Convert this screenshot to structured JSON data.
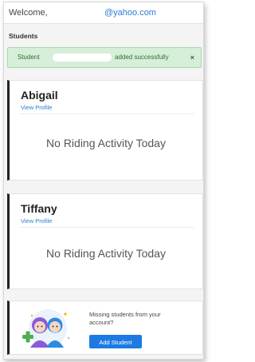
{
  "header": {
    "welcome": "Welcome,",
    "email_domain": "@yahoo.com"
  },
  "section": {
    "title": "Students"
  },
  "alert": {
    "prefix": "Student",
    "suffix": "added successfully",
    "close": "×",
    "color": "#d6efd8"
  },
  "students": [
    {
      "name": "Abigail",
      "link": "View Profile",
      "activity": "No Riding Activity Today"
    },
    {
      "name": "Tiffany",
      "link": "View Profile",
      "activity": "No Riding Activity Today"
    }
  ],
  "missing": {
    "message": "Missing students from your account?",
    "button": "Add Student",
    "illustration": "students-illustration-icon"
  },
  "colors": {
    "accent": "#1d7ae3",
    "link": "#2b7cd3"
  }
}
